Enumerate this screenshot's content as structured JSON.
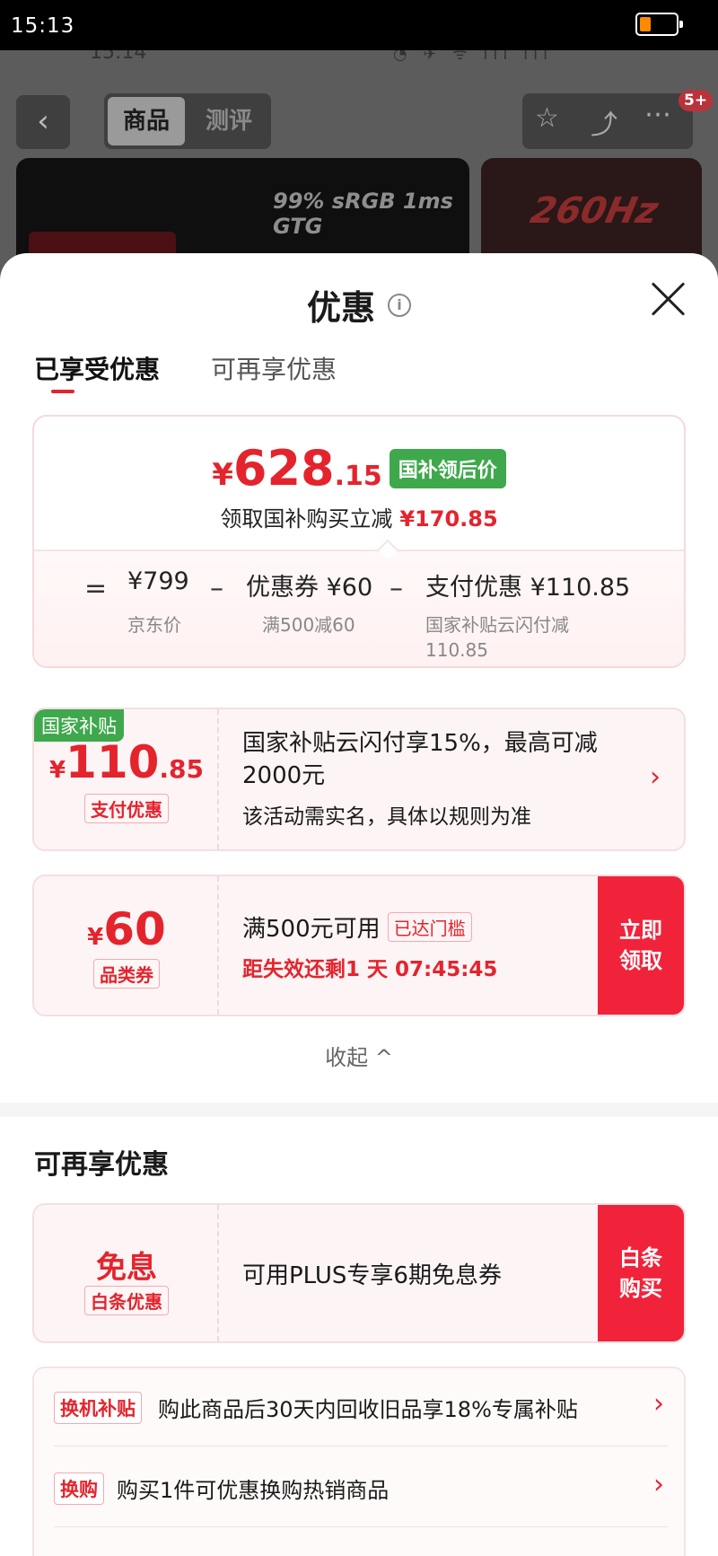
{
  "status_bar": {
    "time": "15:13"
  },
  "background_page": {
    "ghost_time": "15:14",
    "tabs": [
      "商品",
      "测评"
    ],
    "badge": "5+",
    "image_spec": "99% sRGB 1ms GTG",
    "image_hz": "260Hz"
  },
  "sheet": {
    "title": "优惠",
    "tabs": {
      "active": "已享受优惠",
      "inactive": "可再享优惠"
    }
  },
  "summary": {
    "currency": "¥",
    "price_int": "628",
    "price_dec": ".15",
    "tag": "国补领后价",
    "subtitle": "领取国补购买立减",
    "subtitle_amount": "¥170.85",
    "eq": "=",
    "minus": "–",
    "terms": [
      {
        "value": "¥799",
        "label": "京东价"
      },
      {
        "value": "优惠券 ¥60",
        "label": "满500减60"
      },
      {
        "value": "支付优惠 ¥110.85",
        "label": "国家补贴云闪付减 110.85"
      }
    ]
  },
  "coupon_payment": {
    "corner_tag": "国家补贴",
    "currency": "¥",
    "amount_int": "110",
    "amount_dec": ".85",
    "label": "支付优惠",
    "title": "国家补贴云闪付享15%，最高可减2000元",
    "desc": "该活动需实名，具体以规则为准",
    "chevron": "›"
  },
  "coupon_category": {
    "currency": "¥",
    "amount_int": "60",
    "label": "品类券",
    "title": "满500元可用",
    "threshold": "已达门槛",
    "countdown": "距失效还剩1 天 07:45:45",
    "action": "立即领取"
  },
  "collapse": {
    "label": "收起 ^"
  },
  "more_section": {
    "title": "可再享优惠",
    "installment": {
      "amount": "免息",
      "label": "白条优惠",
      "title": "可用PLUS专享6期免息券",
      "action": "白条购买"
    },
    "list": [
      {
        "tag": "换机补贴",
        "text": "购此商品后30天内回收旧品享18%专属补贴",
        "chevron": "›"
      },
      {
        "tag": "换购",
        "text": "购买1件可优惠换购热销商品",
        "chevron": "›"
      }
    ]
  },
  "colors": {
    "accent": "#e4242d",
    "green": "#3fa84d",
    "action_red": "#f1233a"
  }
}
